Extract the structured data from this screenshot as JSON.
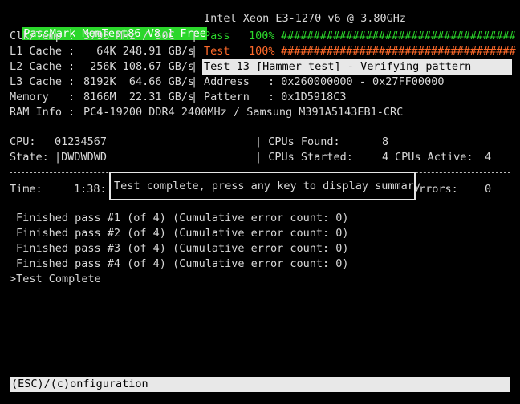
{
  "header": {
    "title": "PassMark MemTest86 V8.1 Free",
    "cpu": "Intel Xeon E3-1270 v6 @ 3.80GHz"
  },
  "left_info": [
    {
      "label": "Clk/Temp :",
      "value": "3793 MHz / 50C"
    },
    {
      "label": "L1 Cache :",
      "value": "  64K 248.91 GB/s"
    },
    {
      "label": "L2 Cache :",
      "value": " 256K 108.67 GB/s"
    },
    {
      "label": "L3 Cache :",
      "value": "8192K  64.66 GB/s"
    },
    {
      "label": "Memory   :",
      "value": "8166M  22.31 GB/s"
    },
    {
      "label": "RAM Info :",
      "value": "PC4-19200 DDR4 2400MHz / Samsung M391A5143EB1-CRC"
    }
  ],
  "progress": {
    "pass_label": "Pass",
    "pass_pct": "100%",
    "pass_bar": "####################################",
    "test_label": "Test",
    "test_pct": "100%",
    "test_bar": "####################################"
  },
  "test_status": "Test 13 [Hammer test] - Verifying pattern",
  "address_label": "Address",
  "address_value": ": 0x260000000 - 0x27FF00000",
  "pattern_label": "Pattern",
  "pattern_value": ": 0x1D5918C3",
  "cpu_info": {
    "cpu_label": "CPU:",
    "cpu_value": "01234567",
    "state_label": "State:",
    "state_value": "|DWDWDWD",
    "cpus_found_label": "| CPUs Found:",
    "cpus_found_value": "8",
    "cpus_started_label": "| CPUs Started:",
    "cpus_started_value": "4",
    "cpus_active_label": "CPUs Active:",
    "cpus_active_value": "4"
  },
  "time_row": {
    "time_label": "Time:",
    "time_value": "1:38:",
    "errors_label": "rrors:",
    "errors_value": "0"
  },
  "popup_text": "Test complete, press any key to display summary",
  "log": [
    "Finished pass #1 (of 4) (Cumulative error count: 0)",
    "Finished pass #2 (of 4) (Cumulative error count: 0)",
    "Finished pass #3 (of 4) (Cumulative error count: 0)",
    "Finished pass #4 (of 4) (Cumulative error count: 0)"
  ],
  "prompt": ">Test Complete",
  "footer": "(ESC)/(c)onfiguration"
}
